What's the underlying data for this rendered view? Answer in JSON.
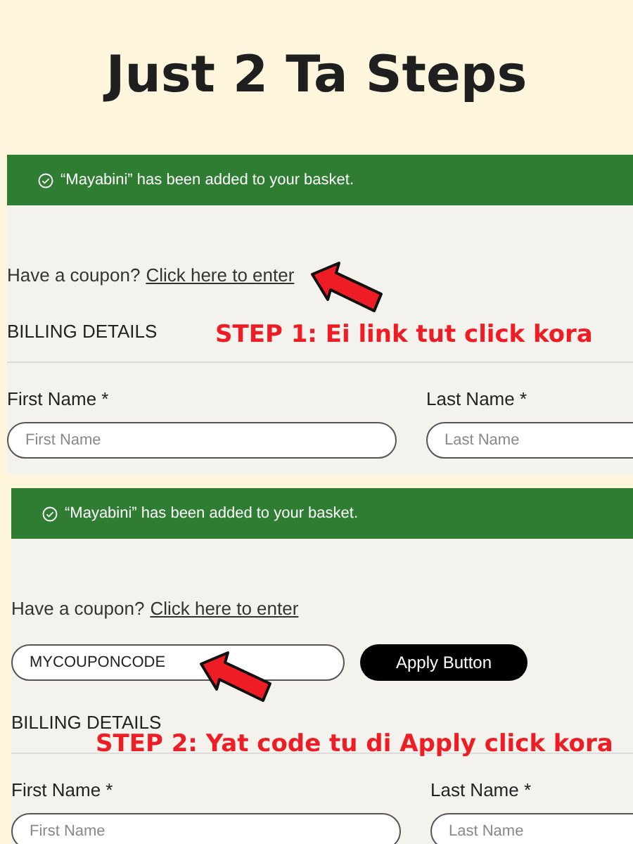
{
  "title": "Just 2 Ta Steps",
  "panels": [
    {
      "notice": "“Mayabini” has been added to your basket.",
      "coupon_prompt": "Have a coupon?",
      "coupon_link": "Click here to enter",
      "billing_heading": "BILLING DETAILS",
      "step_label": "STEP 1: Ei link tut click kora",
      "fields": [
        {
          "label": "First Name *",
          "placeholder": "First Name"
        },
        {
          "label": "Last Name *",
          "placeholder": "Last Name"
        }
      ]
    },
    {
      "notice": "“Mayabini” has been added to your basket.",
      "coupon_prompt": "Have a coupon?",
      "coupon_link": "Click here to enter",
      "coupon_form": {
        "value": "MYCOUPONCODE",
        "button": "Apply Button"
      },
      "billing_heading": "BILLING DETAILS",
      "step_label": "STEP 2: Yat code tu di Apply click kora",
      "fields": [
        {
          "label": "First Name *",
          "placeholder": "First Name"
        },
        {
          "label": "Last Name *",
          "placeholder": "Last Name"
        }
      ]
    }
  ]
}
